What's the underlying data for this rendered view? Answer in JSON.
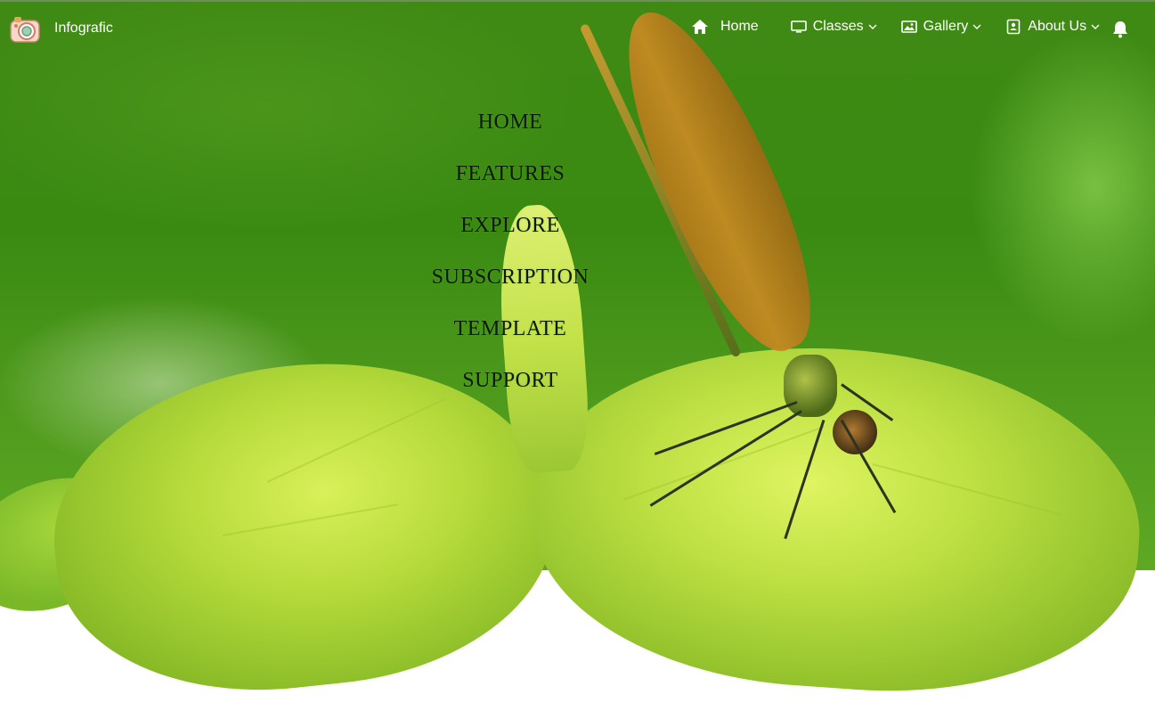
{
  "navbar": {
    "brand": {
      "name": "Infografic",
      "logo_icon": "camera-icon"
    },
    "items": [
      {
        "label": "Home",
        "icon": "home-icon",
        "has_dropdown": false
      },
      {
        "label": "Classes",
        "icon": "monitor-icon",
        "has_dropdown": true
      },
      {
        "label": "Gallery",
        "icon": "image-icon",
        "has_dropdown": true
      },
      {
        "label": "About Us",
        "icon": "contact-card-icon",
        "has_dropdown": true
      }
    ],
    "notification_icon": "bell-icon"
  },
  "menu": {
    "items": [
      "HOME",
      "FEATURES",
      "EXPLORE",
      "SUBSCRIPTION",
      "TEMPLATE",
      "SUPPORT"
    ]
  },
  "colors": {
    "nav_text": "#ffffff",
    "menu_text": "#0b1a06",
    "background_green": "#3f8a14",
    "leaf_green": "#c4e24a"
  }
}
